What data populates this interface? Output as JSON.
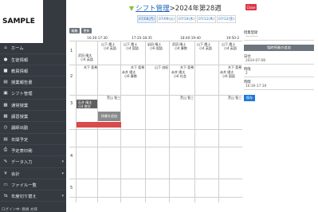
{
  "sidebar": {
    "logo": "SAMPLE",
    "items": [
      {
        "label": "ホーム",
        "icon": "home-icon",
        "glyph": "⌂"
      },
      {
        "label": "生徒情報",
        "icon": "user-icon",
        "glyph": "●"
      },
      {
        "label": "教員情報",
        "icon": "teacher-icon",
        "glyph": "■"
      },
      {
        "label": "授業報告書",
        "icon": "report-icon",
        "glyph": "▤"
      },
      {
        "label": "シフト管理",
        "icon": "shift-icon",
        "glyph": "▣"
      },
      {
        "label": "通常授業",
        "icon": "class-icon",
        "glyph": "▦"
      },
      {
        "label": "講習授業",
        "icon": "course-icon",
        "glyph": "▦"
      },
      {
        "label": "講師出勤",
        "icon": "clock-icon",
        "glyph": "◷"
      },
      {
        "label": "年間予定",
        "icon": "calendar-icon",
        "glyph": "▤"
      },
      {
        "label": "予定表印刷",
        "icon": "print-icon",
        "glyph": "⎙"
      },
      {
        "label": "データ入力",
        "icon": "data-icon",
        "glyph": "✎",
        "caret": "▾"
      },
      {
        "label": "会計",
        "icon": "money-icon",
        "glyph": "¥",
        "caret": "▾"
      },
      {
        "label": "ファイル一覧",
        "icon": "folder-icon",
        "glyph": "▭"
      },
      {
        "label": "年度切り替え",
        "icon": "switch-icon",
        "glyph": "⇆",
        "caret": "▾"
      }
    ],
    "footer": "ログイン中: 教員 太郎"
  },
  "main": {
    "breadcrumb_home": "シフト管理",
    "breadcrumb_current": ">2024年第28週",
    "date_tabs": [
      "07/08(月)",
      "07/09(火)",
      "07/10(水)",
      "07/11(木)",
      "07/12(金)"
    ],
    "btn_edit": "編集",
    "btn_update": "更新",
    "time_slots": [
      "16:30-17:30",
      "17:35-18:35",
      "18:40-19:40",
      "19:50-2"
    ],
    "rows": [
      "1",
      "2",
      "3",
      "4",
      "5"
    ],
    "cells": {
      "r1_teachers": [
        "山下 霞士",
        "山下 霞士",
        "岩田 晴士",
        "武田 晴士",
        "山下 霞士",
        "山下 霞士"
      ],
      "r1_subjects": [
        "小4 英語",
        "小4 国語",
        "小6 国語",
        "小4 算数",
        "小4 英語",
        "小4 英語"
      ],
      "r1_extra_name": "武田 晴太",
      "r1_extra_subj": "小4 英語",
      "r2_headers": [
        "木下 亜希",
        "木下 亜希",
        "山下 由紀",
        "木下 亜希",
        "木下 亜希"
      ],
      "r2_names": [
        "赤井 陽太",
        "赤井 陽太",
        "赤井 陽太"
      ],
      "r2_subjs": [
        "小6 算数",
        "小6 社会",
        "小6 国語"
      ],
      "r3_headers": [
        "荒山 智三",
        "荒山 智三",
        "荒山 智三"
      ],
      "r3_dark_name": "石井 晴太",
      "r3_dark_subj": "小4 数学",
      "r3_add": "授業を追加"
    }
  },
  "right_panel": {
    "close": "Close",
    "label_class": "授業登録",
    "select_placeholder": "----------",
    "btn_transfer": "臨時授業の追加",
    "label_date": "日付",
    "date_value": "2024-07-08",
    "label_period": "時限",
    "period_value": "2",
    "label_time": "時間",
    "time_value": "16:30-17:30",
    "btn_save": "保存"
  },
  "colors": {
    "sidebar_bg": "#343a40",
    "accent": "#1e63b5",
    "close": "#dc3545",
    "red_bar": "#d94a4a"
  }
}
